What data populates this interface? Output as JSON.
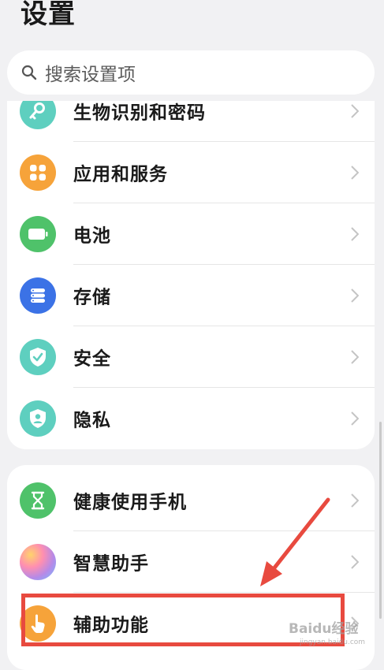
{
  "header": {
    "title": "设置"
  },
  "search": {
    "placeholder": "搜索设置项",
    "icon": "search-icon"
  },
  "group1": {
    "items": [
      {
        "label": "生物识别和密码",
        "icon": "key-icon",
        "color": "#5ecfbf"
      },
      {
        "label": "应用和服务",
        "icon": "apps-grid-icon",
        "color": "#f6a33a"
      },
      {
        "label": "电池",
        "icon": "battery-icon",
        "color": "#4fc26a"
      },
      {
        "label": "存储",
        "icon": "storage-icon",
        "color": "#3b72e6"
      },
      {
        "label": "安全",
        "icon": "shield-check-icon",
        "color": "#5ecfbf"
      },
      {
        "label": "隐私",
        "icon": "privacy-shield-icon",
        "color": "#5ecfbf"
      }
    ]
  },
  "group2": {
    "items": [
      {
        "label": "健康使用手机",
        "icon": "hourglass-icon",
        "color": "#4fc26a"
      },
      {
        "label": "智慧助手",
        "icon": "assistant-orb-icon",
        "color": "#c98de0"
      },
      {
        "label": "辅助功能",
        "icon": "hand-pointer-icon",
        "color": "#f6a33a"
      }
    ]
  },
  "annotation": {
    "highlight_color": "#e84a3f"
  },
  "watermark": {
    "text": "Baidu经验",
    "sub": "jingyan.baidu.com"
  }
}
